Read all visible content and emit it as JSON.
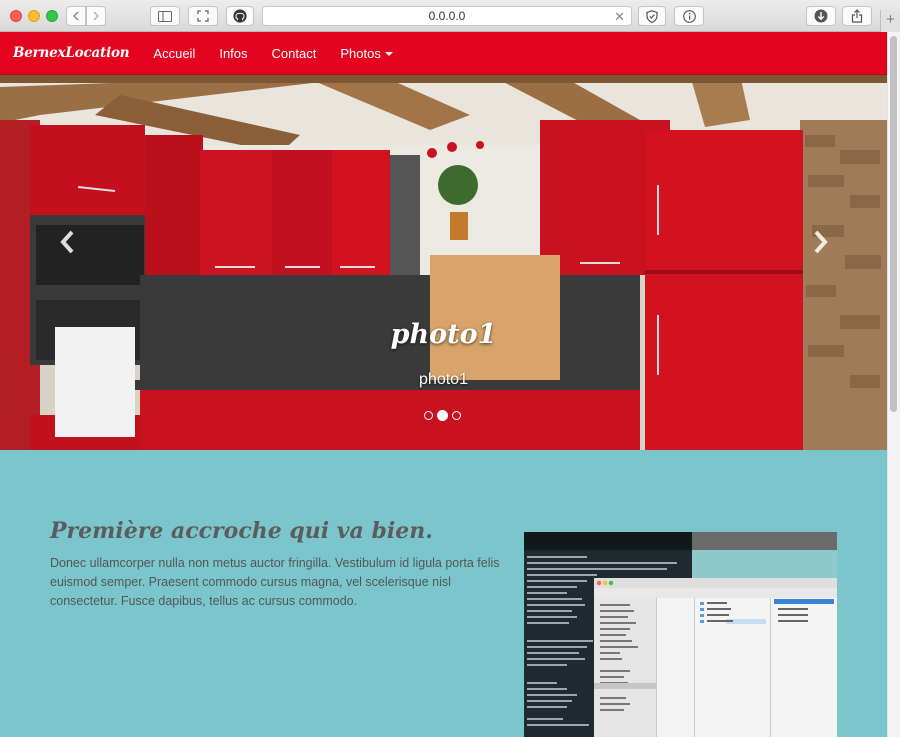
{
  "browser": {
    "url": "0.0.0.0"
  },
  "navbar": {
    "brand": "BernexLocation",
    "links": [
      "Accueil",
      "Infos",
      "Contact"
    ],
    "dropdown_label": "Photos"
  },
  "carousel": {
    "caption_title": "photo1",
    "caption_text": "photo1",
    "slide_count": 3,
    "active_index": 1
  },
  "feature": {
    "heading": "Première accroche qui va bien.",
    "body": "Donec ullamcorper nulla non metus auctor fringilla. Vestibulum id ligula porta felis euismod semper. Praesent commodo cursus magna, vel scelerisque nisl consectetur. Fusce dapibus, tellus ac cursus commodo."
  },
  "colors": {
    "navbar": "#e3051f",
    "section_bg": "#7ac6cc",
    "heading": "#5d5c5c"
  }
}
